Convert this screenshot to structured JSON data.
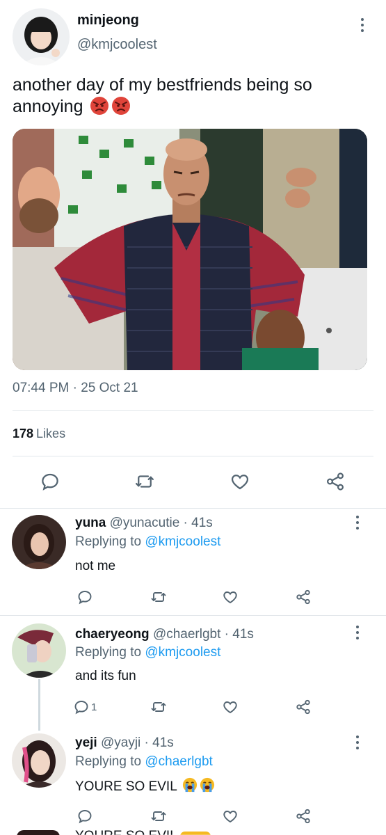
{
  "main_tweet": {
    "display_name": "minjeong",
    "handle": "@kmjcoolest",
    "text": "another day of my bestfriends being so annoying",
    "emojis": [
      "angry-face",
      "angry-face"
    ],
    "timestamp": "07:44 PM · 25 Oct 21",
    "likes_count": "178",
    "likes_label": "Likes",
    "actions": [
      "reply-icon",
      "retweet-icon",
      "like-icon",
      "share-icon"
    ]
  },
  "replies": [
    {
      "display_name": "yuna",
      "handle": "@yunacutie · 41s",
      "replying_prefix": "Replying to",
      "replying_to": "@kmjcoolest",
      "text": "not me",
      "emojis": [],
      "reply_count": ""
    },
    {
      "display_name": "chaeryeong",
      "handle": "@chaerlgbt · 41s",
      "replying_prefix": "Replying to",
      "replying_to": "@kmjcoolest",
      "text": "and its fun",
      "emojis": [],
      "reply_count": "1"
    },
    {
      "display_name": "yeji",
      "handle": "@yayji · 41s",
      "replying_prefix": "Replying to",
      "replying_to": "@chaerlgbt",
      "text": "YOURE SO EVIL",
      "emojis": [
        "loudly-crying-face",
        "loudly-crying-face"
      ],
      "reply_count": ""
    }
  ],
  "partial_next_text": "YOURE SO EVIL",
  "colors": {
    "link": "#1d9bf0",
    "secondary_text": "#536471",
    "divider": "#e1e6ea",
    "angry_emoji": "#e0443a",
    "crying_emoji": "#f5b922"
  }
}
